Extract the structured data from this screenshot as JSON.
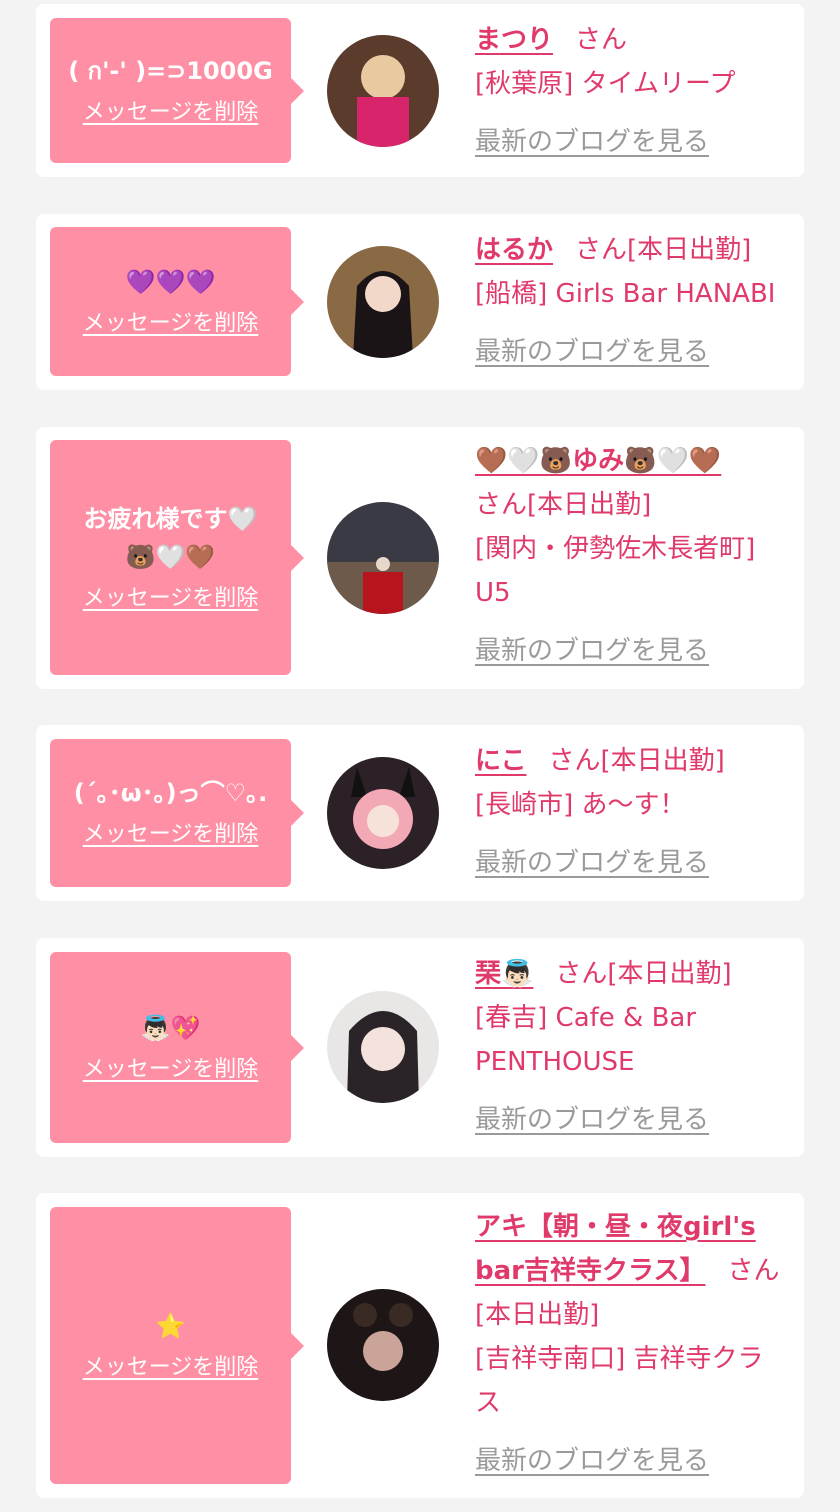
{
  "cards": [
    {
      "message": "( ก'-' )=⊃1000G",
      "delete_label": "メッセージを削除",
      "name": "まつり",
      "suffix": "さん",
      "status": "",
      "shop": "[秋葉原] タイムリープ",
      "blog_label": "最新のブログを見る"
    },
    {
      "message": "💜💜💜",
      "delete_label": "メッセージを削除",
      "name": "はるか",
      "suffix": "さん",
      "status": "[本日出勤]",
      "shop": "[船橋] Girls Bar HANABI",
      "blog_label": "最新のブログを見る"
    },
    {
      "message": "お疲れ様です🤍\n🐻🤍🤎",
      "delete_label": "メッセージを削除",
      "name": "🤎🤍🐻ゆみ🐻🤍🤎",
      "suffix": "さん",
      "status": "[本日出勤]",
      "shop": "[関内・伊勢佐木長者町] U5",
      "blog_label": "最新のブログを見る"
    },
    {
      "message": "(´｡･ω･｡)っ⌒♡｡.",
      "delete_label": "メッセージを削除",
      "name": "にこ",
      "suffix": "さん",
      "status": "[本日出勤]",
      "shop": "[長崎市] あ～す！",
      "blog_label": "最新のブログを見る"
    },
    {
      "message": "👼🏻💖",
      "delete_label": "メッセージを削除",
      "name": "琹👼🏻",
      "suffix": "さん",
      "status": "[本日出勤]",
      "shop": "[春吉] Cafe & Bar PENTHOUSE",
      "blog_label": "最新のブログを見る"
    },
    {
      "message": "⭐",
      "delete_label": "メッセージを削除",
      "name": "アキ【朝・昼・夜girl's bar吉祥寺クラス】",
      "suffix": "さん",
      "status": "[本日出勤]",
      "shop": "[吉祥寺南口] 吉祥寺クラス",
      "blog_label": "最新のブログを見る"
    }
  ],
  "colors": {
    "accent": "#e03a6a",
    "bubble": "#ff8fa4",
    "muted": "#9a9a9a",
    "background": "#f3f3f3"
  }
}
